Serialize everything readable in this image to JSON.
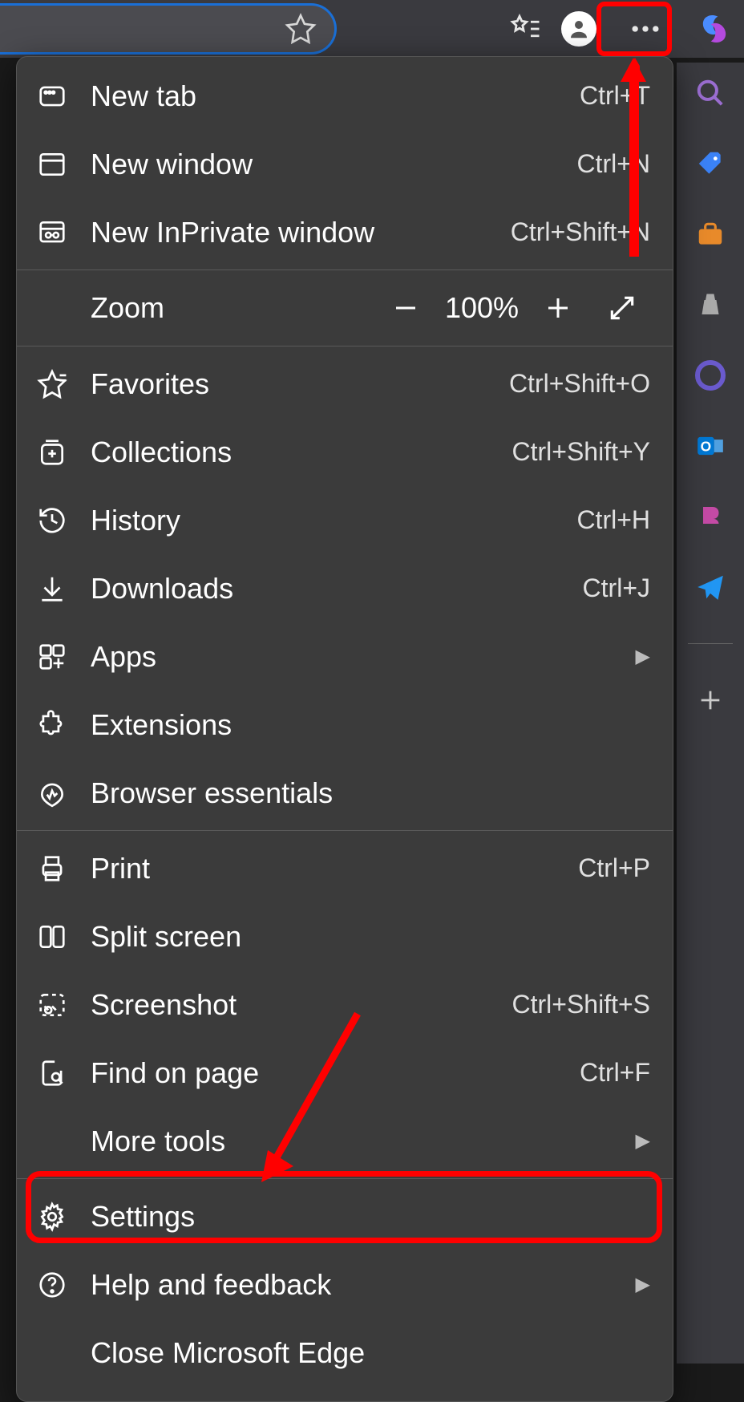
{
  "toolbar": {
    "favorites_star": "star-icon",
    "favorites_list": "favorites-list-icon",
    "profile": "profile-icon",
    "more": "more-dots-icon",
    "copilot": "copilot-icon"
  },
  "menu": {
    "items": [
      {
        "icon": "new-tab-icon",
        "label": "New tab",
        "shortcut": "Ctrl+T"
      },
      {
        "icon": "new-window-icon",
        "label": "New window",
        "shortcut": "Ctrl+N"
      },
      {
        "icon": "inprivate-icon",
        "label": "New InPrivate window",
        "shortcut": "Ctrl+Shift+N"
      }
    ],
    "zoom": {
      "label": "Zoom",
      "value": "100%"
    },
    "items2": [
      {
        "icon": "favorites-icon",
        "label": "Favorites",
        "shortcut": "Ctrl+Shift+O"
      },
      {
        "icon": "collections-icon",
        "label": "Collections",
        "shortcut": "Ctrl+Shift+Y"
      },
      {
        "icon": "history-icon",
        "label": "History",
        "shortcut": "Ctrl+H"
      },
      {
        "icon": "downloads-icon",
        "label": "Downloads",
        "shortcut": "Ctrl+J"
      },
      {
        "icon": "apps-icon",
        "label": "Apps",
        "submenu": true
      },
      {
        "icon": "extensions-icon",
        "label": "Extensions"
      },
      {
        "icon": "browser-essentials-icon",
        "label": "Browser essentials"
      }
    ],
    "items3": [
      {
        "icon": "print-icon",
        "label": "Print",
        "shortcut": "Ctrl+P"
      },
      {
        "icon": "split-screen-icon",
        "label": "Split screen"
      },
      {
        "icon": "screenshot-icon",
        "label": "Screenshot",
        "shortcut": "Ctrl+Shift+S"
      },
      {
        "icon": "find-icon",
        "label": "Find on page",
        "shortcut": "Ctrl+F"
      },
      {
        "icon": "",
        "label": "More tools",
        "submenu": true
      }
    ],
    "items4": [
      {
        "icon": "settings-icon",
        "label": "Settings"
      },
      {
        "icon": "help-icon",
        "label": "Help and feedback",
        "submenu": true
      },
      {
        "icon": "",
        "label": "Close Microsoft Edge"
      }
    ]
  },
  "sidebar": {
    "items": [
      {
        "name": "search-icon",
        "color": "#a060d0"
      },
      {
        "name": "tag-icon",
        "color": "#3b82f6"
      },
      {
        "name": "briefcase-icon",
        "color": "#e88a2a"
      },
      {
        "name": "games-icon",
        "color": "#888888"
      },
      {
        "name": "office-icon",
        "color": "#6a5acd"
      },
      {
        "name": "outlook-icon",
        "color": "#0078d4"
      },
      {
        "name": "power-icon",
        "color": "#c44aa5"
      },
      {
        "name": "send-icon",
        "color": "#2196f3"
      }
    ],
    "add": "add-tool-icon"
  }
}
